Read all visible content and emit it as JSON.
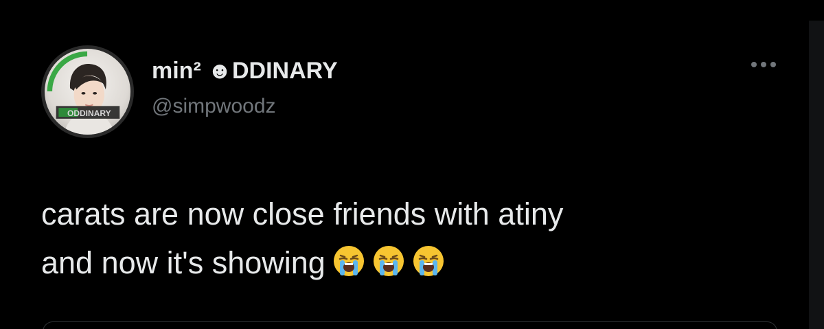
{
  "tweet": {
    "display_name": "min² ☻DDINARY",
    "handle": "@simpwoodz",
    "text_line1": "carats are now close friends with atiny",
    "text_line2": "and now it's showing",
    "emojis": [
      "loudly-crying-face",
      "loudly-crying-face",
      "loudly-crying-face"
    ],
    "avatar_badge_text": "ODDINARY"
  },
  "colors": {
    "background": "#000000",
    "primary_text": "#e7e9ea",
    "secondary_text": "#71767b",
    "border": "#2f3336"
  }
}
